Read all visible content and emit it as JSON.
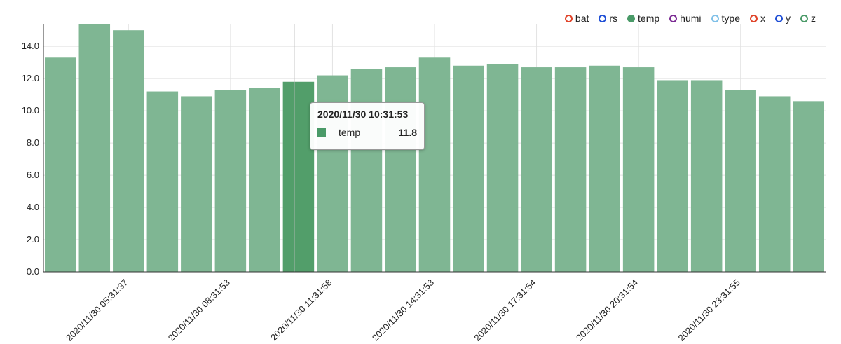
{
  "legend": [
    {
      "name": "bat",
      "color": "#e0442a",
      "filled": false
    },
    {
      "name": "rs",
      "color": "#1f4fd6",
      "filled": false
    },
    {
      "name": "temp",
      "color": "#4a9a68",
      "filled": true
    },
    {
      "name": "humi",
      "color": "#7b2a93",
      "filled": false
    },
    {
      "name": "type",
      "color": "#7fc0e8",
      "filled": false
    },
    {
      "name": "x",
      "color": "#e0442a",
      "filled": false
    },
    {
      "name": "y",
      "color": "#1f4fd6",
      "filled": false
    },
    {
      "name": "z",
      "color": "#4a9a68",
      "filled": false
    }
  ],
  "tooltip": {
    "title": "2020/11/30 10:31:53",
    "series": "temp",
    "value": "11.8",
    "color": "#4a9a68"
  },
  "chart_data": {
    "type": "bar",
    "ylim": [
      0,
      15.4
    ],
    "y_ticks": [
      "0.0",
      "2.0",
      "4.0",
      "6.0",
      "8.0",
      "10.0",
      "12.0",
      "14.0"
    ],
    "x_tick_labels": [
      {
        "label": "2020/11/30 05:31:37",
        "index": 2
      },
      {
        "label": "2020/11/30 08:31:53",
        "index": 5
      },
      {
        "label": "2020/11/30 11:31:58",
        "index": 8
      },
      {
        "label": "2020/11/30 14:31:53",
        "index": 11
      },
      {
        "label": "2020/11/30 17:31:54",
        "index": 14
      },
      {
        "label": "2020/11/30 20:31:54",
        "index": 17
      },
      {
        "label": "2020/11/30 23:31:55",
        "index": 20
      }
    ],
    "highlight_index": 7,
    "series": [
      {
        "name": "temp",
        "color": "#7fb693",
        "highlight_color": "#529e6a",
        "values": [
          13.3,
          15.4,
          15.0,
          11.2,
          10.9,
          11.3,
          11.4,
          11.8,
          12.2,
          12.6,
          12.7,
          13.3,
          12.8,
          12.9,
          12.7,
          12.7,
          12.8,
          12.7,
          11.9,
          11.9,
          11.3,
          10.9,
          10.6
        ]
      }
    ],
    "grid": true
  }
}
